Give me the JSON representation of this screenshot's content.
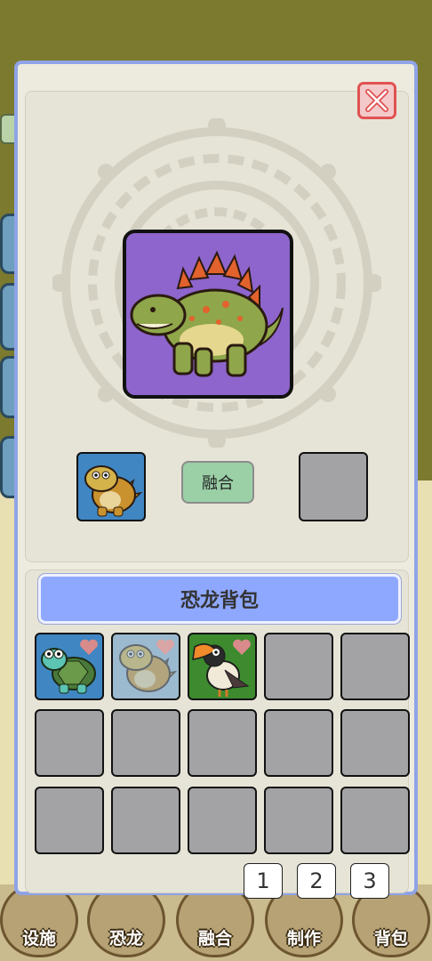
{
  "modal": {
    "close_icon": "close-x-icon",
    "main_creature": "stegosaurus",
    "fusion_slot_left": "spiky-turtle-dino",
    "fusion_slot_right": "",
    "fuse_label": "融合"
  },
  "backpack": {
    "title": "恐龙背包",
    "items": [
      {
        "creature": "turtle",
        "favorite": true,
        "state": "normal"
      },
      {
        "creature": "spiky-turtle-dino",
        "favorite": true,
        "state": "selected-dimmed"
      },
      {
        "creature": "toucan-bird",
        "favorite": true,
        "state": "normal"
      },
      {
        "creature": "",
        "state": "empty"
      },
      {
        "creature": "",
        "state": "empty"
      },
      {
        "creature": "",
        "state": "empty"
      },
      {
        "creature": "",
        "state": "empty"
      },
      {
        "creature": "",
        "state": "empty"
      },
      {
        "creature": "",
        "state": "empty"
      },
      {
        "creature": "",
        "state": "empty"
      },
      {
        "creature": "",
        "state": "empty"
      },
      {
        "creature": "",
        "state": "empty"
      },
      {
        "creature": "",
        "state": "empty"
      },
      {
        "creature": "",
        "state": "empty"
      },
      {
        "creature": "",
        "state": "empty"
      }
    ],
    "pages": [
      "1",
      "2",
      "3"
    ],
    "active_page": "1"
  },
  "nav": {
    "items": [
      "设施",
      "恐龙",
      "融合",
      "制作",
      "背包"
    ]
  },
  "colors": {
    "accent": "#8fa8ff",
    "close": "#e05252",
    "fuse": "#9bd0a7",
    "card_purple": "#8d65cc"
  }
}
